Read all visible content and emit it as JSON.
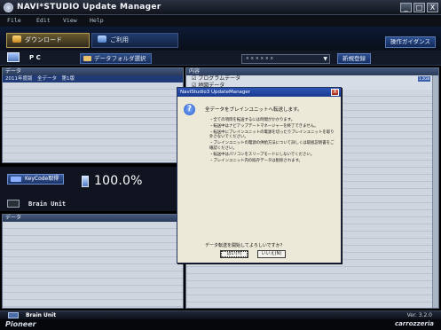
{
  "titlebar": {
    "title": "NAVI*STUDIO Update Manager",
    "buttons": [
      "_",
      "□",
      "X"
    ]
  },
  "menu": [
    "File",
    "Edit",
    "View",
    "Help"
  ],
  "tabs": [
    {
      "label": "ダウンロード",
      "active": true
    },
    {
      "label": "ご利用",
      "active": false
    }
  ],
  "operation_guide": "操作ガイダンス",
  "toolbar": {
    "pc_label": "P C",
    "folder_button": "データフォルダ選択",
    "device_select": "ｘｘｘｘｘｘ",
    "new_register": "新規登録"
  },
  "left_panel": {
    "header": "データ",
    "rows": [
      "2011年度版　全データ　第1版"
    ]
  },
  "right_panel": {
    "header": "内容",
    "tag": "1.2GB",
    "lines": [
      "☑ プログラムデータ",
      "☑ 地図データ"
    ]
  },
  "midbar": {
    "keycode_button": "KeyCode取得",
    "usage_percent": "100.0%",
    "brain_unit": "Brain Unit"
  },
  "bottom_panel": {
    "header": "データ"
  },
  "dialog": {
    "title": "NaviStudio3 UpdateManager",
    "close": "X",
    "heading": "全データをブレインユニットへ転送します。",
    "items": [
      "・全ての項目を転送するには時間がかかります。",
      "・転送中はナビアップデートマネージャーを終了できません。",
      "・転送中にブレインユニットの電源を切ったりブレインユニットを取り外さないでください。",
      "・ブレインユニットの電源の供給方法について詳しくは取扱説明書をご確認ください。",
      "・転送中はパソコンをスリープモードにしないでください。",
      "・ブレインユニット内の既存データは削除されます。"
    ],
    "question": "データ転送を開始してよろしいですか？",
    "yes_button": "はい(Y)",
    "no_button": "いいえ(N)"
  },
  "statusbar": {
    "label": "Brain Unit",
    "version": "Ver. 3.2.0"
  },
  "footer": {
    "brand_left": "Pioneer",
    "brand_right": "carrozzeria"
  }
}
